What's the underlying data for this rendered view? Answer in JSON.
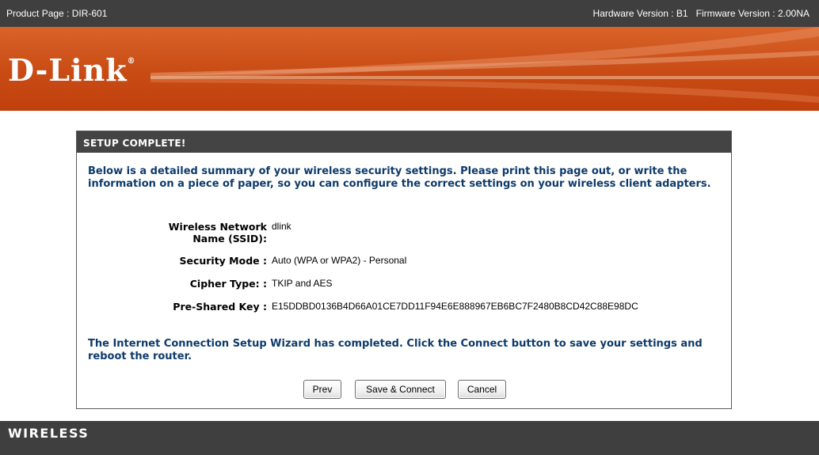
{
  "topbar": {
    "product": "Product Page : DIR-601",
    "versions": "Hardware Version : B1   Firmware Version : 2.00NA"
  },
  "brand": {
    "logo": "D-Link",
    "mark": "®"
  },
  "panel": {
    "title": "SETUP COMPLETE!",
    "intro": "Below is a detailed summary of your wireless security settings. Please print this page out, or write the information on a piece of paper, so you can configure the correct settings on your wireless client adapters.",
    "fields": [
      {
        "label": "Wireless Network Name (SSID):",
        "value": "dlink"
      },
      {
        "label": "Security Mode :",
        "value": "Auto (WPA or WPA2) - Personal"
      },
      {
        "label": "Cipher Type: :",
        "value": "TKIP and AES"
      },
      {
        "label": "Pre-Shared Key :",
        "value": "E15DDBD0136B4D66A01CE7DD11F94E6E888967EB6BC7F2480B8CD42C88E98DC"
      }
    ],
    "outro": "The Internet Connection Setup Wizard has completed. Click the Connect button to save your settings and reboot the router.",
    "buttons": {
      "prev": "Prev",
      "save": "Save & Connect",
      "cancel": "Cancel"
    }
  },
  "footer": {
    "label": "WIRELESS"
  },
  "colors": {
    "banner": "#c84b14",
    "bar": "#3f3f3f",
    "heading_text": "#0d3a6b"
  }
}
